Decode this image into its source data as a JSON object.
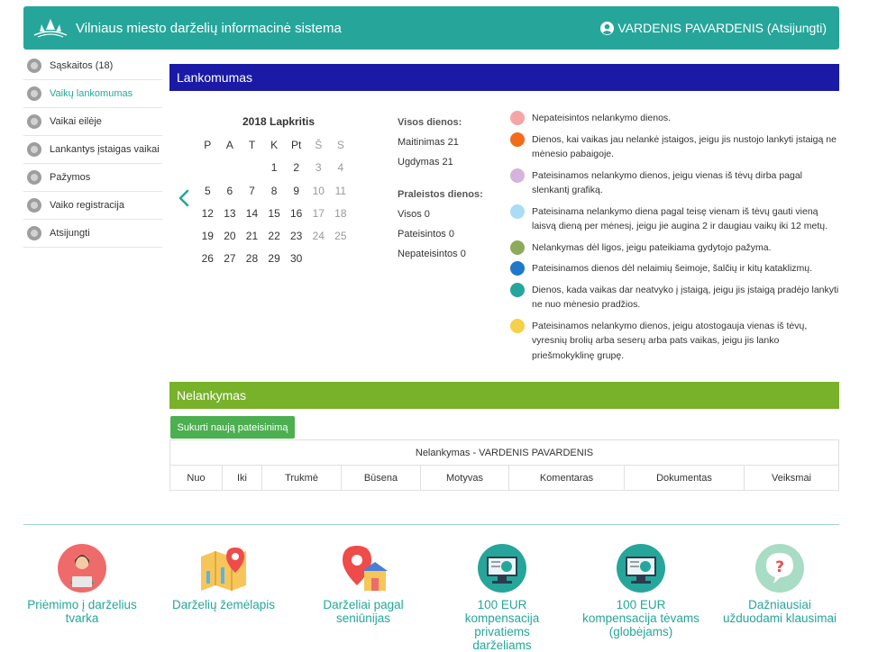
{
  "header": {
    "logo_icon": "kindergarten-logo-icon",
    "title": "Vilniaus miesto darželių informacinė sistema",
    "user_icon": "user-circle-icon",
    "user_name": "VARDENIS PAVARDENIS (Atsijungti)"
  },
  "sidebar": {
    "items": [
      {
        "label": "Sąskaitos (18)",
        "icon": "coins-icon",
        "active": false
      },
      {
        "label": "Vaikų lankomumas",
        "icon": "bell-icon",
        "active": true
      },
      {
        "label": "Vaikai eilėje",
        "icon": "people-icon",
        "active": false
      },
      {
        "label": "Lankantys įstaigas vaikai",
        "icon": "location-pin-icon",
        "active": false
      },
      {
        "label": "Pažymos",
        "icon": "pencil-icon",
        "active": false
      },
      {
        "label": "Vaiko registracija",
        "icon": "edit-icon",
        "active": false
      },
      {
        "label": "Atsijungti",
        "icon": "logout-icon",
        "active": false
      }
    ]
  },
  "attendance": {
    "title": "Lankomumas",
    "calendar": {
      "month_title": "2018 Lapkritis",
      "weekdays": [
        "P",
        "A",
        "T",
        "K",
        "Pt",
        "Š",
        "S"
      ],
      "days": [
        "",
        "",
        "",
        "1",
        "2",
        "3",
        "4",
        "5",
        "6",
        "7",
        "8",
        "9",
        "10",
        "11",
        "12",
        "13",
        "14",
        "15",
        "16",
        "17",
        "18",
        "19",
        "20",
        "21",
        "22",
        "23",
        "24",
        "25",
        "26",
        "27",
        "28",
        "29",
        "30",
        "",
        ""
      ]
    },
    "stats": {
      "all_days_label": "Visos dienos:",
      "meals": "Maitinimas 21",
      "education": "Ugdymas 21",
      "missed_label": "Praleistos dienos:",
      "all": "Visos 0",
      "justified": "Pateisintos 0",
      "unjustified": "Nepateisintos 0"
    },
    "legend": [
      {
        "color": "#f4a6a6",
        "text": "Nepateisintos nelankymo dienos."
      },
      {
        "color": "#f26c1a",
        "text": "Dienos, kai vaikas jau nelankė įstaigos, jeigu jis nustojo lankyti įstaigą ne mėnesio pabaigoje."
      },
      {
        "color": "#d6b3dc",
        "text": "Pateisinamos nelankymo dienos, jeigu vienas iš tėvų dirba pagal slenkantį grafiką."
      },
      {
        "color": "#a9dcf7",
        "text": "Pateisinama nelankymo diena pagal teisę vienam iš tėvų gauti vieną laisvą dieną per mėnesį, jeigu jie augina 2 ir daugiau vaikų iki 12 metų."
      },
      {
        "color": "#8eab5c",
        "text": "Nelankymas dėl ligos, jeigu pateikiama gydytojo pažyma."
      },
      {
        "color": "#1f78c8",
        "text": "Pateisinamos dienos dėl nelaimių šeimoje, šalčių ir kitų kataklizmų."
      },
      {
        "color": "#26a69a",
        "text": "Dienos, kada vaikas dar neatvyko į įstaigą, jeigu jis įstaigą pradėjo lankyti ne nuo mėnesio pradžios."
      },
      {
        "color": "#f7d04a",
        "text": "Pateisinamos nelankymo dienos, jeigu atostogauja vienas iš tėvų, vyresnių brolių arba seserų arba pats vaikas, jeigu jis lanko priešmokyklinę grupę."
      }
    ]
  },
  "absence": {
    "title": "Nelankymas",
    "create_button": "Sukurti naują pateisinimą",
    "table_caption": "Nelankymas - VARDENIS PAVARDENIS",
    "columns": [
      "Nuo",
      "Iki",
      "Trukmė",
      "Būsena",
      "Motyvas",
      "Komentaras",
      "Dokumentas",
      "Veiksmai"
    ]
  },
  "footer": {
    "links": [
      {
        "label": "Priėmimo į darželius tvarka",
        "icon": "admission-person-icon"
      },
      {
        "label": "Darželių žemėlapis",
        "icon": "map-icon"
      },
      {
        "label": "Darželiai pagal seniūnijas",
        "icon": "map-pin-house-icon"
      },
      {
        "label": "100 EUR kompensacija privatiems darželiams",
        "icon": "computer-globe-icon"
      },
      {
        "label": "100 EUR kompensacija tėvams (globėjams)",
        "icon": "computer-globe-icon"
      },
      {
        "label": "Dažniausiai užduodami klausimai",
        "icon": "question-bubble-icon"
      }
    ]
  }
}
